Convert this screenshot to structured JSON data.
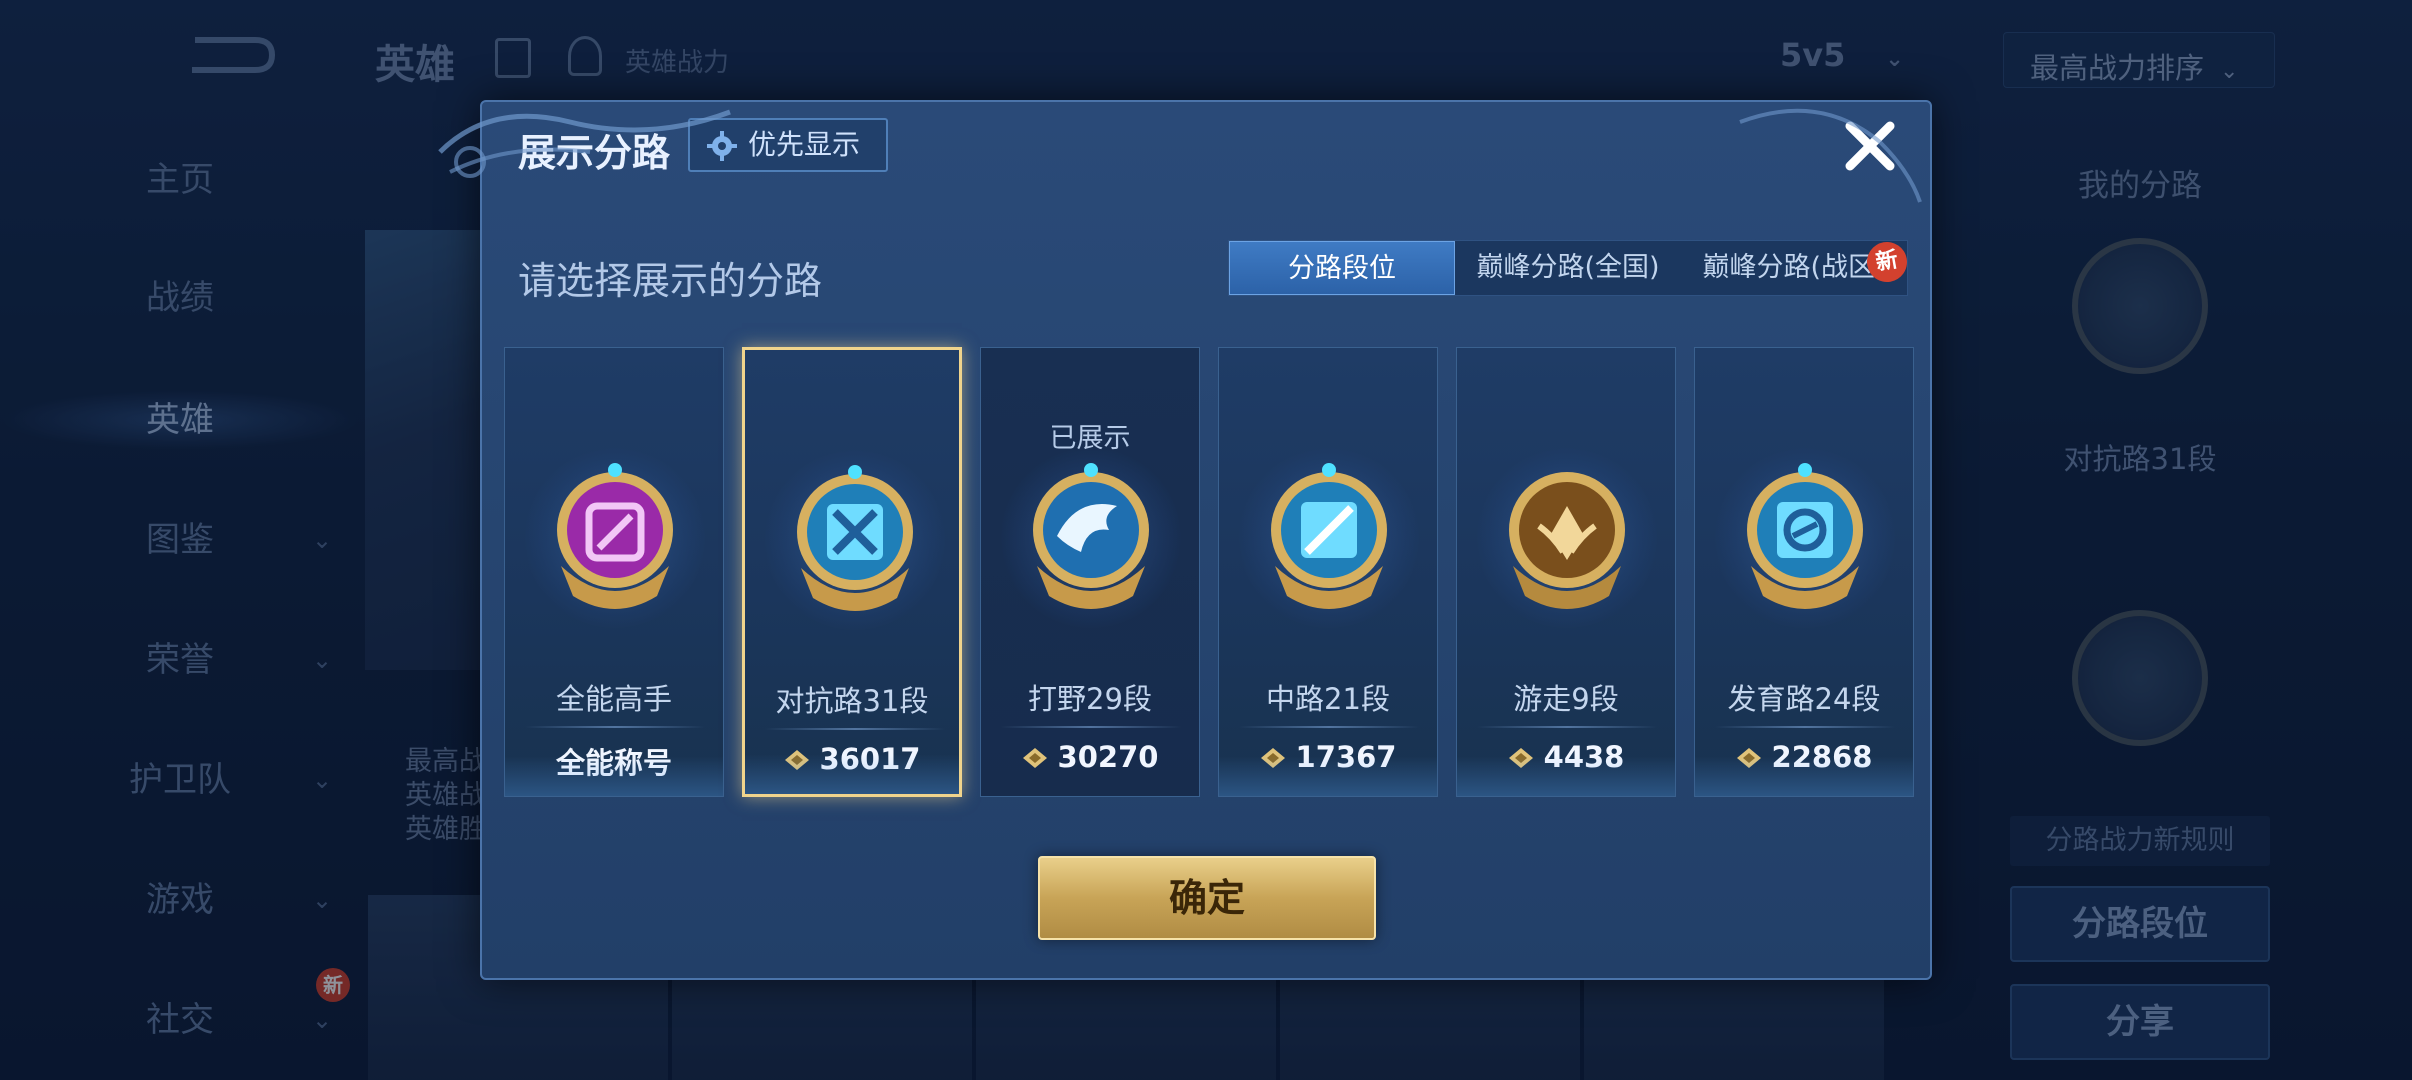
{
  "background": {
    "header": {
      "title": "英雄",
      "power_label": "英雄战力",
      "mode": "5v5",
      "sort": "最高战力排序"
    },
    "sidebar": [
      {
        "label": "主页",
        "chevron": false
      },
      {
        "label": "战绩",
        "chevron": false
      },
      {
        "label": "英雄",
        "chevron": false,
        "active": true
      },
      {
        "label": "图鉴",
        "chevron": true
      },
      {
        "label": "荣誉",
        "chevron": true
      },
      {
        "label": "护卫队",
        "chevron": true
      },
      {
        "label": "游戏",
        "chevron": true
      },
      {
        "label": "社交",
        "chevron": true,
        "badge": "新"
      }
    ],
    "hero_card_text": [
      "最高战",
      "英雄战",
      "英雄胜"
    ],
    "right_panel": {
      "title": "我的分路",
      "lane_label": "对抗路31段",
      "rule_label": "分路战力新规则",
      "lane_rank_button": "分路段位",
      "share_button": "分享"
    }
  },
  "dialog": {
    "title": "展示分路",
    "priority_button": "优先显示",
    "subtitle": "请选择展示的分路",
    "tabs": [
      {
        "label": "分路段位",
        "active": true
      },
      {
        "label": "巅峰分路(全国)",
        "active": false
      },
      {
        "label": "巅峰分路(战区)",
        "active": false
      }
    ],
    "tab_new_badge": "新",
    "cards": [
      {
        "title": "全能高手",
        "value": "全能称号",
        "show_power_icon": false,
        "emblem": "allround-emblem-icon",
        "selected": false,
        "shown_label": ""
      },
      {
        "title": "对抗路31段",
        "value": "36017",
        "show_power_icon": true,
        "emblem": "clash-lane-emblem-icon",
        "selected": true,
        "shown_label": ""
      },
      {
        "title": "打野29段",
        "value": "30270",
        "show_power_icon": true,
        "emblem": "jungle-emblem-icon",
        "selected": false,
        "shown_label": "已展示"
      },
      {
        "title": "中路21段",
        "value": "17367",
        "show_power_icon": true,
        "emblem": "mid-lane-emblem-icon",
        "selected": false,
        "shown_label": ""
      },
      {
        "title": "游走9段",
        "value": "4438",
        "show_power_icon": true,
        "emblem": "roam-emblem-icon",
        "selected": false,
        "shown_label": ""
      },
      {
        "title": "发育路24段",
        "value": "22868",
        "show_power_icon": true,
        "emblem": "farm-lane-emblem-icon",
        "selected": false,
        "shown_label": ""
      }
    ],
    "confirm_button": "确定"
  },
  "colors": {
    "accent_gold": "#e9cf8a",
    "tab_active": "#3f7bc4",
    "dialog_bg": "#264570",
    "selected_border": "#f0d48c"
  }
}
